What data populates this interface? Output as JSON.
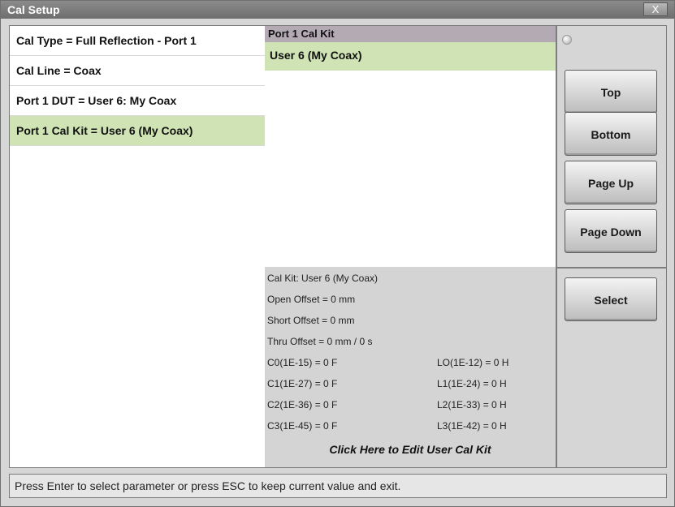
{
  "window": {
    "title": "Cal Setup",
    "close_label": "X"
  },
  "left": {
    "items": [
      {
        "label": "Cal Type = Full Reflection - Port 1",
        "selected": false
      },
      {
        "label": "Cal Line = Coax",
        "selected": false
      },
      {
        "label": "Port 1 DUT = User 6: My Coax",
        "selected": false
      },
      {
        "label": "Port 1 Cal Kit = User 6 (My Coax)",
        "selected": true
      }
    ]
  },
  "middle": {
    "header": "Port 1 Cal Kit",
    "list": [
      {
        "label": "User 6 (My Coax)",
        "selected": true
      }
    ],
    "details": {
      "kit": "Cal Kit: User 6 (My Coax)",
      "open_offset": "Open Offset = 0 mm",
      "short_offset": "Short Offset = 0 mm",
      "thru_offset": "Thru Offset = 0 mm / 0 s",
      "c0": "C0(1E-15) = 0 F",
      "c1": "C1(1E-27) = 0 F",
      "c2": "C2(1E-36) = 0 F",
      "c3": "C3(1E-45) = 0 F",
      "l0": "LO(1E-12) = 0 H",
      "l1": "L1(1E-24) = 0 H",
      "l2": "L2(1E-33) = 0 H",
      "l3": "L3(1E-42) = 0 H",
      "edit_link": "Click Here to Edit User Cal Kit"
    }
  },
  "right": {
    "top": "Top",
    "bottom": "Bottom",
    "page_up": "Page Up",
    "page_down": "Page Down",
    "select": "Select"
  },
  "status": {
    "message": "Press Enter to select parameter or press ESC to keep current value and exit."
  }
}
